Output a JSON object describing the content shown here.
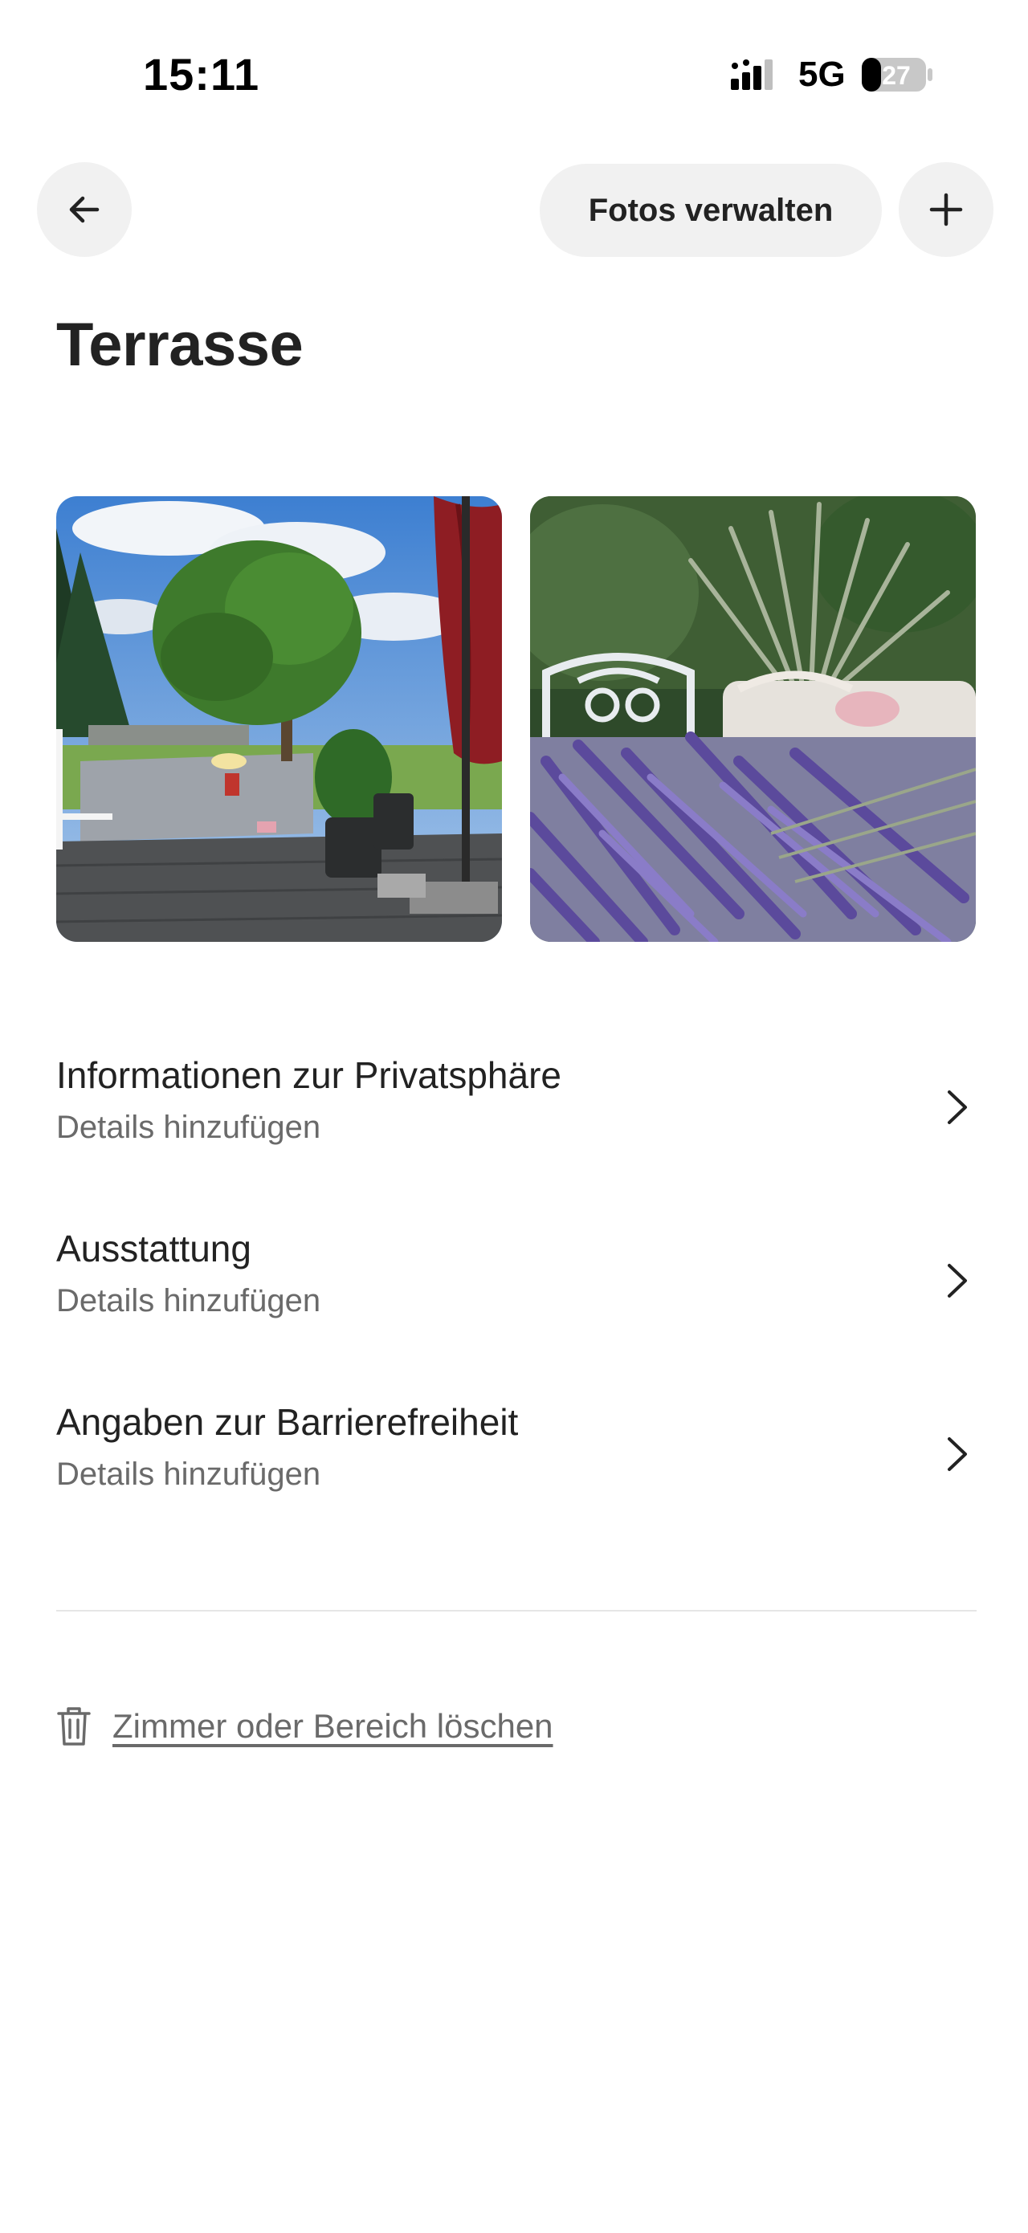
{
  "status_bar": {
    "time": "15:11",
    "network": "5G",
    "battery": "27"
  },
  "header": {
    "back_icon": "arrow-left-icon",
    "manage_photos_label": "Fotos verwalten",
    "add_icon": "plus-icon"
  },
  "page": {
    "title": "Terrasse"
  },
  "photos": [
    {
      "subject": "garden terrace with red parasol and tree"
    },
    {
      "subject": "lavender bouquet on white garden bench"
    }
  ],
  "rows": [
    {
      "title": "Informationen zur Privatsphäre",
      "subtitle": "Details hinzufügen",
      "icon": "chevron-right-icon"
    },
    {
      "title": "Ausstattung",
      "subtitle": "Details hinzufügen",
      "icon": "chevron-right-icon"
    },
    {
      "title": "Angaben zur Barrierefreiheit",
      "subtitle": "Details hinzufügen",
      "icon": "chevron-right-icon"
    }
  ],
  "delete": {
    "icon": "trash-icon",
    "label": "Zimmer oder Bereich löschen"
  },
  "colors": {
    "text_primary": "#222222",
    "text_secondary": "#6a6a6a",
    "button_bg": "#f1f1f1",
    "divider": "#e6e6e6"
  }
}
